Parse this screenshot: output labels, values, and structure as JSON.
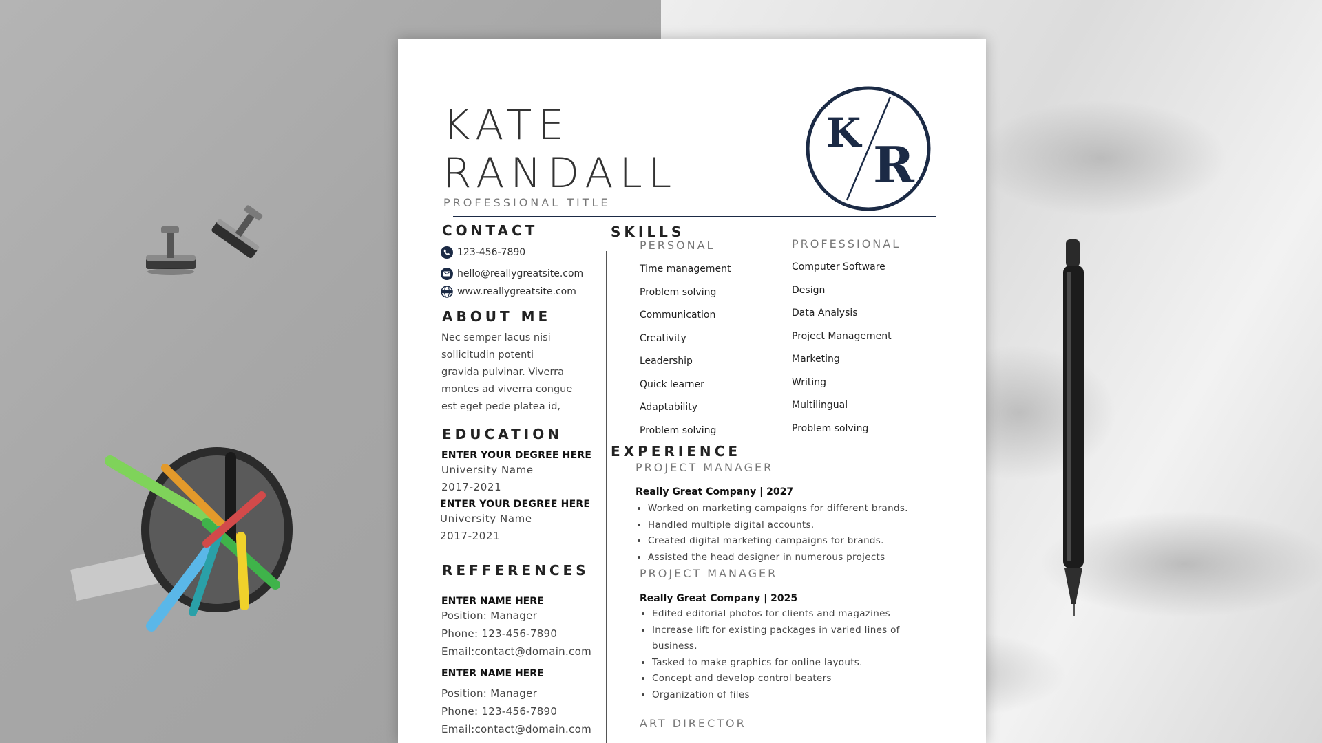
{
  "resume": {
    "first_name": "KATE",
    "last_name": "RANDALL",
    "professional_title": "PROFESSIONAL TITLE",
    "monogram": {
      "left": "K",
      "right": "R",
      "color": "#1b2a45"
    },
    "contact": {
      "heading": "CONTACT",
      "phone": "123-456-7890",
      "email": "hello@reallygreatsite.com",
      "website": "www.reallygreatsite.com",
      "phone_icon": "phone-icon",
      "email_icon": "mail-icon",
      "website_icon": "globe-icon"
    },
    "about": {
      "heading": "ABOUT ME",
      "lines": [
        "Nec semper lacus nisi",
        "sollicitudin potenti",
        "gravida pulvinar. Viverra",
        "montes ad viverra congue",
        "est eget pede platea id,"
      ]
    },
    "education": {
      "heading": "EDUCATION",
      "entries": [
        {
          "degree": "ENTER YOUR DEGREE HERE",
          "school": "University Name",
          "years": "2017-2021"
        },
        {
          "degree": "ENTER YOUR DEGREE HERE",
          "school": "University Name",
          "years": "2017-2021"
        }
      ]
    },
    "references": {
      "heading": "REFFERENCES",
      "entries": [
        {
          "name": "ENTER NAME HERE",
          "position": "Position: Manager",
          "phone": "Phone: 123-456-7890",
          "email": "Email:contact@domain.com"
        },
        {
          "name": "ENTER NAME HERE",
          "position": "Position: Manager",
          "phone": "Phone: 123-456-7890",
          "email": "Email:contact@domain.com"
        }
      ]
    },
    "skills": {
      "heading": "SKILLS",
      "personal_heading": "PERSONAL",
      "personal": [
        "Time management",
        "Problem solving",
        "Communication",
        "Creativity",
        "Leadership",
        "Quick learner",
        "Adaptability",
        "Problem solving"
      ],
      "professional_heading": "PROFESSIONAL",
      "professional": [
        "Computer Software",
        "Design",
        "Data Analysis",
        "Project Management",
        "Marketing",
        "Writing",
        "Multilingual",
        "Problem solving"
      ]
    },
    "experience": {
      "heading": "EXPERIENCE",
      "jobs": [
        {
          "title": "PROJECT MANAGER",
          "company": "Really Great Company  | 2027",
          "bullets": [
            "Worked on marketing campaigns for different brands.",
            "Handled multiple digital accounts.",
            "Created digital marketing campaigns for brands.",
            "Assisted the head designer in numerous projects"
          ]
        },
        {
          "title": "PROJECT MANAGER",
          "company": "Really Great Company  | 2025",
          "bullets": [
            "Edited editorial photos for clients and magazines",
            "Increase lift for existing packages in varied lines of business.",
            "Tasked to make graphics for online layouts.",
            "Concept and develop control beaters",
            "Organization of files"
          ]
        },
        {
          "title": "ART DIRECTOR"
        }
      ]
    },
    "accent_color": "#1b2a45"
  }
}
